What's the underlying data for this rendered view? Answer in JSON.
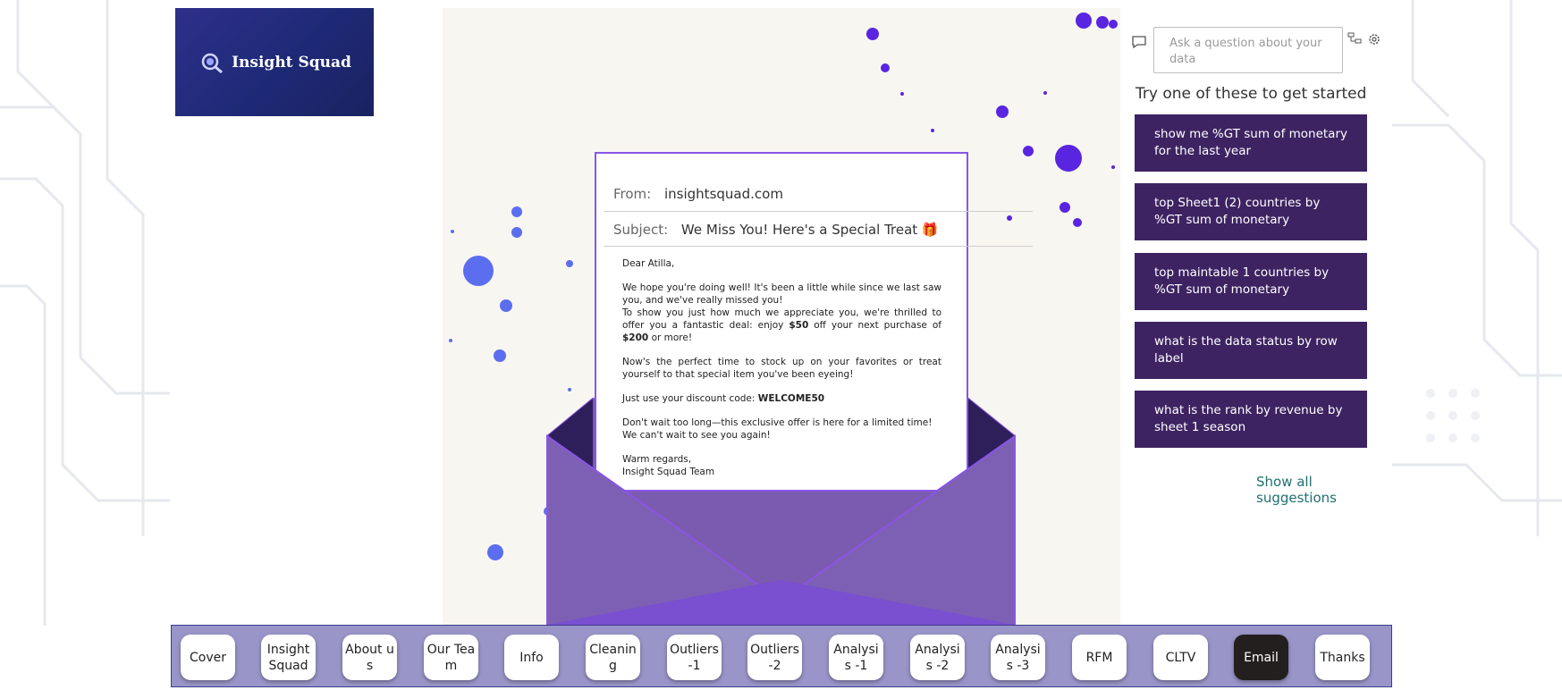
{
  "logo": {
    "text": "Insight Squad"
  },
  "email": {
    "from_label": "From:",
    "from_value": "insightsquad.com",
    "subject_label": "Subject:",
    "subject_value": "We Miss You! Here's a Special Treat 🎁",
    "greeting": "Dear Atilla,",
    "para1": "We hope you're doing well! It's been a little while since we last saw you, and we've really missed you!",
    "para2_pre": "To show you just how much we appreciate you, we're thrilled to offer you a fantastic deal: enjoy ",
    "para2_amount": "$50",
    "para2_mid": " off your next purchase of ",
    "para2_min": "$200",
    "para2_post": " or more!",
    "para3": "Now's the perfect time to stock up on your favorites or treat yourself to that special item you've been eyeing!",
    "para4_pre": "Just use your discount code: ",
    "para4_code": "WELCOME50",
    "para5a": "Don't wait too long—this exclusive offer is here for a limited time!",
    "para5b": "We can't wait to see you again!",
    "closing": "Warm regards,",
    "signature": "Insight Squad Team"
  },
  "qa": {
    "placeholder": "Ask a question about your data",
    "heading": "Try one of these to get started",
    "suggestions": [
      "show me %GT sum of monetary for the last year",
      "top Sheet1 (2) countries by %GT sum of monetary",
      "top maintable 1 countries by %GT sum of monetary",
      "what is the data status by row label",
      "what is the rank by revenue by sheet 1 season"
    ],
    "show_all": "Show all suggestions"
  },
  "nav": {
    "items": [
      "Cover",
      "Insight Squad",
      "About us",
      "Our Team",
      "Info",
      "Cleaning",
      "Outliers -1",
      "Outliers -2",
      "Analysis -1",
      "Analysis -2",
      "Analysis -3",
      "RFM",
      "CLTV",
      "Email",
      "Thanks"
    ],
    "active": "Email"
  },
  "colors": {
    "nav_active": "#231f1f",
    "suggestion_bg": "#3e2362",
    "envelope": "#7b5bb0",
    "accent_purple": "#8a55e6"
  }
}
